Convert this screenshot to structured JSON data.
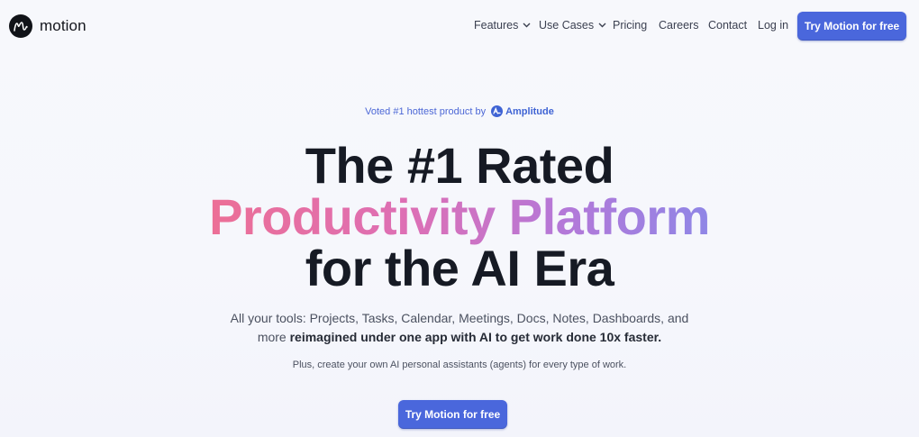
{
  "header": {
    "brand": "motion",
    "nav": [
      {
        "label": "Features",
        "dropdown": true
      },
      {
        "label": "Use Cases",
        "dropdown": true
      },
      {
        "label": "Pricing"
      },
      {
        "label": "Careers"
      },
      {
        "label": "Contact"
      },
      {
        "label": "Log in"
      }
    ],
    "cta_label": "Try Motion for free"
  },
  "hero": {
    "voted_text": "Voted #1 hottest product by",
    "voted_brand": "Amplitude",
    "headline_line1": "The #1 Rated",
    "headline_line2": "Productivity Platform",
    "headline_line3": "for the AI Era",
    "sub_plain_1": "All your tools: Projects, Tasks, Calendar, Meetings, Docs, Notes, Dashboards, and",
    "sub_plain_2": "more ",
    "sub_bold": "reimagined under one app with AI to get work done 10x faster.",
    "sub2": "Plus, create your own AI personal assistants (agents) for every type of work.",
    "cta_label": "Try Motion for free"
  },
  "colors": {
    "accent": "#4a67dc",
    "gradient_start": "#ec6f96",
    "gradient_end": "#8f86e6"
  }
}
